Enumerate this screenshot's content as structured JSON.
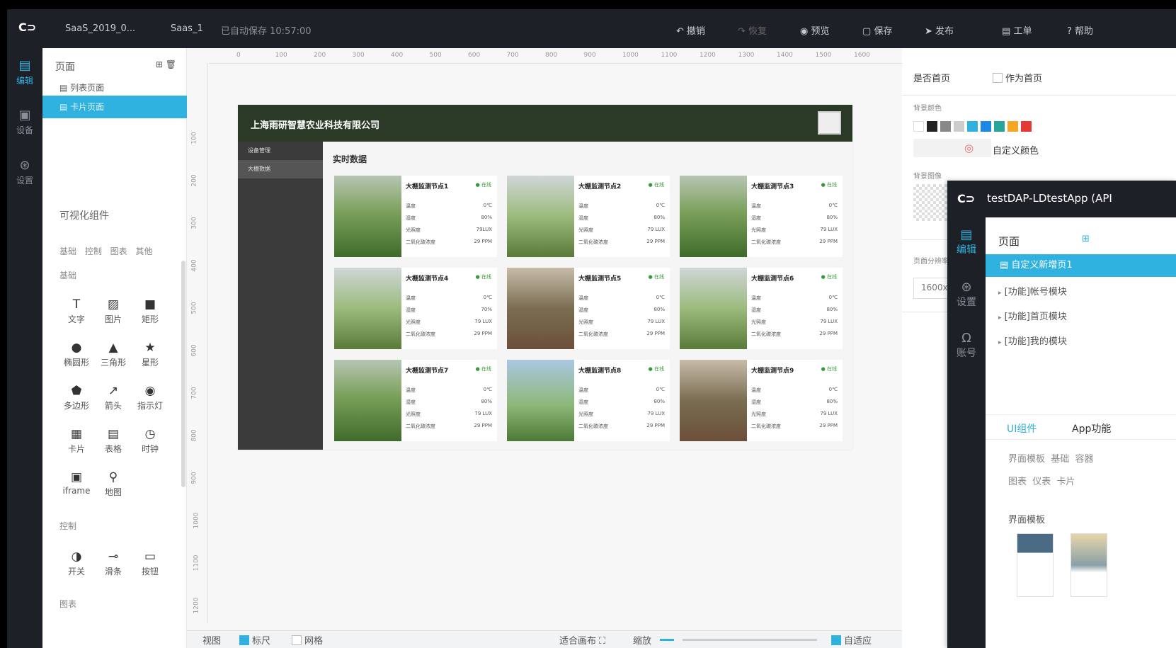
{
  "topbar": {
    "logo": "C⊃",
    "file": "SaaS_2019_0...",
    "app": "Saas_1",
    "autosave": "已自动保存 10:57:00",
    "undo": "撤销",
    "redo": "恢复",
    "preview": "预览",
    "save": "保存",
    "publish": "发布",
    "ticket": "工单",
    "help": "帮助"
  },
  "leftnav": [
    {
      "icon": "▤",
      "label": "编辑"
    },
    {
      "icon": "▣",
      "label": "设备"
    },
    {
      "icon": "⊛",
      "label": "设置"
    }
  ],
  "pages": {
    "title": "页面",
    "items": [
      "列表页面",
      "卡片页面"
    ]
  },
  "components": {
    "title": "可视化组件",
    "tabs": "基础 控制 图表 其他",
    "basic": "基础",
    "control": "控制",
    "chart": "图表",
    "items": [
      {
        "icon": "T",
        "label": "文字"
      },
      {
        "icon": "▨",
        "label": "图片"
      },
      {
        "icon": "■",
        "label": "矩形"
      },
      {
        "icon": "●",
        "label": "椭圆形"
      },
      {
        "icon": "▲",
        "label": "三角形"
      },
      {
        "icon": "★",
        "label": "星形"
      },
      {
        "icon": "⬟",
        "label": "多边形"
      },
      {
        "icon": "↗",
        "label": "箭头"
      },
      {
        "icon": "◉",
        "label": "指示灯"
      },
      {
        "icon": "▦",
        "label": "卡片"
      },
      {
        "icon": "▤",
        "label": "表格"
      },
      {
        "icon": "◷",
        "label": "时钟"
      },
      {
        "icon": "▣",
        "label": "iframe"
      },
      {
        "icon": "⚲",
        "label": "地图"
      }
    ],
    "controls": [
      {
        "icon": "◑",
        "label": "开关"
      },
      {
        "icon": "⊸",
        "label": "滑条"
      },
      {
        "icon": "▭",
        "label": "按钮"
      }
    ]
  },
  "ruler": {
    "h": [
      "0",
      "100",
      "200",
      "300",
      "400",
      "500",
      "600",
      "700",
      "800",
      "900",
      "1000",
      "1100",
      "1200",
      "1300",
      "1400",
      "1500",
      "1600"
    ],
    "v": [
      "100",
      "200",
      "300",
      "400",
      "500",
      "600",
      "700",
      "800",
      "900",
      "1000",
      "1100",
      "1200"
    ]
  },
  "site": {
    "title": "上海雨研智慧农业科技有限公司",
    "menu": [
      "设备管理",
      "大棚数据"
    ],
    "main_title": "实时数据",
    "cards": [
      {
        "title": "大棚监测节点1",
        "status": "● 在线",
        "rows": [
          [
            "温度",
            "0℃"
          ],
          [
            "湿度",
            "80%"
          ],
          [
            "光照度",
            "79LUX"
          ],
          [
            "二氧化碳浓度",
            "29 PPM"
          ]
        ]
      },
      {
        "title": "大棚监测节点2",
        "status": "● 在线",
        "rows": [
          [
            "温度",
            "0℃"
          ],
          [
            "湿度",
            "80%"
          ],
          [
            "光照度",
            "79 LUX"
          ],
          [
            "二氧化碳浓度",
            "29 PPM"
          ]
        ]
      },
      {
        "title": "大棚监测节点3",
        "status": "● 在线",
        "rows": [
          [
            "温度",
            "0℃"
          ],
          [
            "湿度",
            "80%"
          ],
          [
            "光照度",
            "79 LUX"
          ],
          [
            "二氧化碳浓度",
            "29 PPM"
          ]
        ]
      },
      {
        "title": "大棚监测节点4",
        "status": "● 在线",
        "rows": [
          [
            "温度",
            "0℃"
          ],
          [
            "湿度",
            "70%"
          ],
          [
            "光照度",
            "79 LUX"
          ],
          [
            "二氧化碳浓度",
            "29 PPM"
          ]
        ]
      },
      {
        "title": "大棚监测节点5",
        "status": "● 在线",
        "rows": [
          [
            "温度",
            "0℃"
          ],
          [
            "湿度",
            "80%"
          ],
          [
            "光照度",
            "79 LUX"
          ],
          [
            "二氧化碳浓度",
            "29 PPM"
          ]
        ]
      },
      {
        "title": "大棚监测节点6",
        "status": "● 在线",
        "rows": [
          [
            "温度",
            "0℃"
          ],
          [
            "湿度",
            "80%"
          ],
          [
            "光照度",
            "79 LUX"
          ],
          [
            "二氧化碳浓度",
            "29 PPM"
          ]
        ]
      },
      {
        "title": "大棚监测节点7",
        "status": "● 在线",
        "rows": [
          [
            "温度",
            "0℃"
          ],
          [
            "湿度",
            "80%"
          ],
          [
            "光照度",
            "79 LUX"
          ],
          [
            "二氧化碳浓度",
            "29 PPM"
          ]
        ]
      },
      {
        "title": "大棚监测节点8",
        "status": "● 在线",
        "rows": [
          [
            "温度",
            "0℃"
          ],
          [
            "湿度",
            "80%"
          ],
          [
            "光照度",
            "79 LUX"
          ],
          [
            "二氧化碳浓度",
            "29 PPM"
          ]
        ]
      },
      {
        "title": "大棚监测节点9",
        "status": "● 在线",
        "rows": [
          [
            "温度",
            "0℃"
          ],
          [
            "湿度",
            "80%"
          ],
          [
            "光照度",
            "79 LUX"
          ],
          [
            "二氧化碳浓度",
            "29 PPM"
          ]
        ]
      }
    ]
  },
  "right": {
    "home": "是否首页",
    "as_home": "作为首页",
    "bg_color": "背景颜色",
    "custom_color": "自定义颜色",
    "bg_image": "背景图像",
    "resolution_label": "页面分辨率",
    "resolution": "1600x",
    "swatches": [
      "#ffffff",
      "#222222",
      "#888888",
      "#cccccc",
      "#2fb2e0",
      "#1e88e5",
      "#26a69a",
      "#f5a623",
      "#e53935"
    ]
  },
  "overlay": {
    "logo": "C⊃",
    "title": "testDAP-LDtestApp (API",
    "pages_title": "页面",
    "selected": "自定义新增页1",
    "modules": [
      "[功能]帐号模块",
      "[功能]首页模块",
      "[功能]我的模块"
    ],
    "nav": [
      {
        "icon": "▤",
        "label": "编辑"
      },
      {
        "icon": "⊛",
        "label": "设置"
      },
      {
        "icon": "Ω",
        "label": "账号"
      }
    ],
    "tab_ui": "UI组件",
    "tab_app": "App功能",
    "cats1": "界面模板  基础  容器",
    "cats2": "图表  仪表  卡片",
    "template_title": "界面模板"
  },
  "bottom": {
    "view": "视图",
    "ruler": "标尺",
    "grid": "网格",
    "fit": "适合画布",
    "zoom": "缩放",
    "adaptive": "自适应"
  }
}
